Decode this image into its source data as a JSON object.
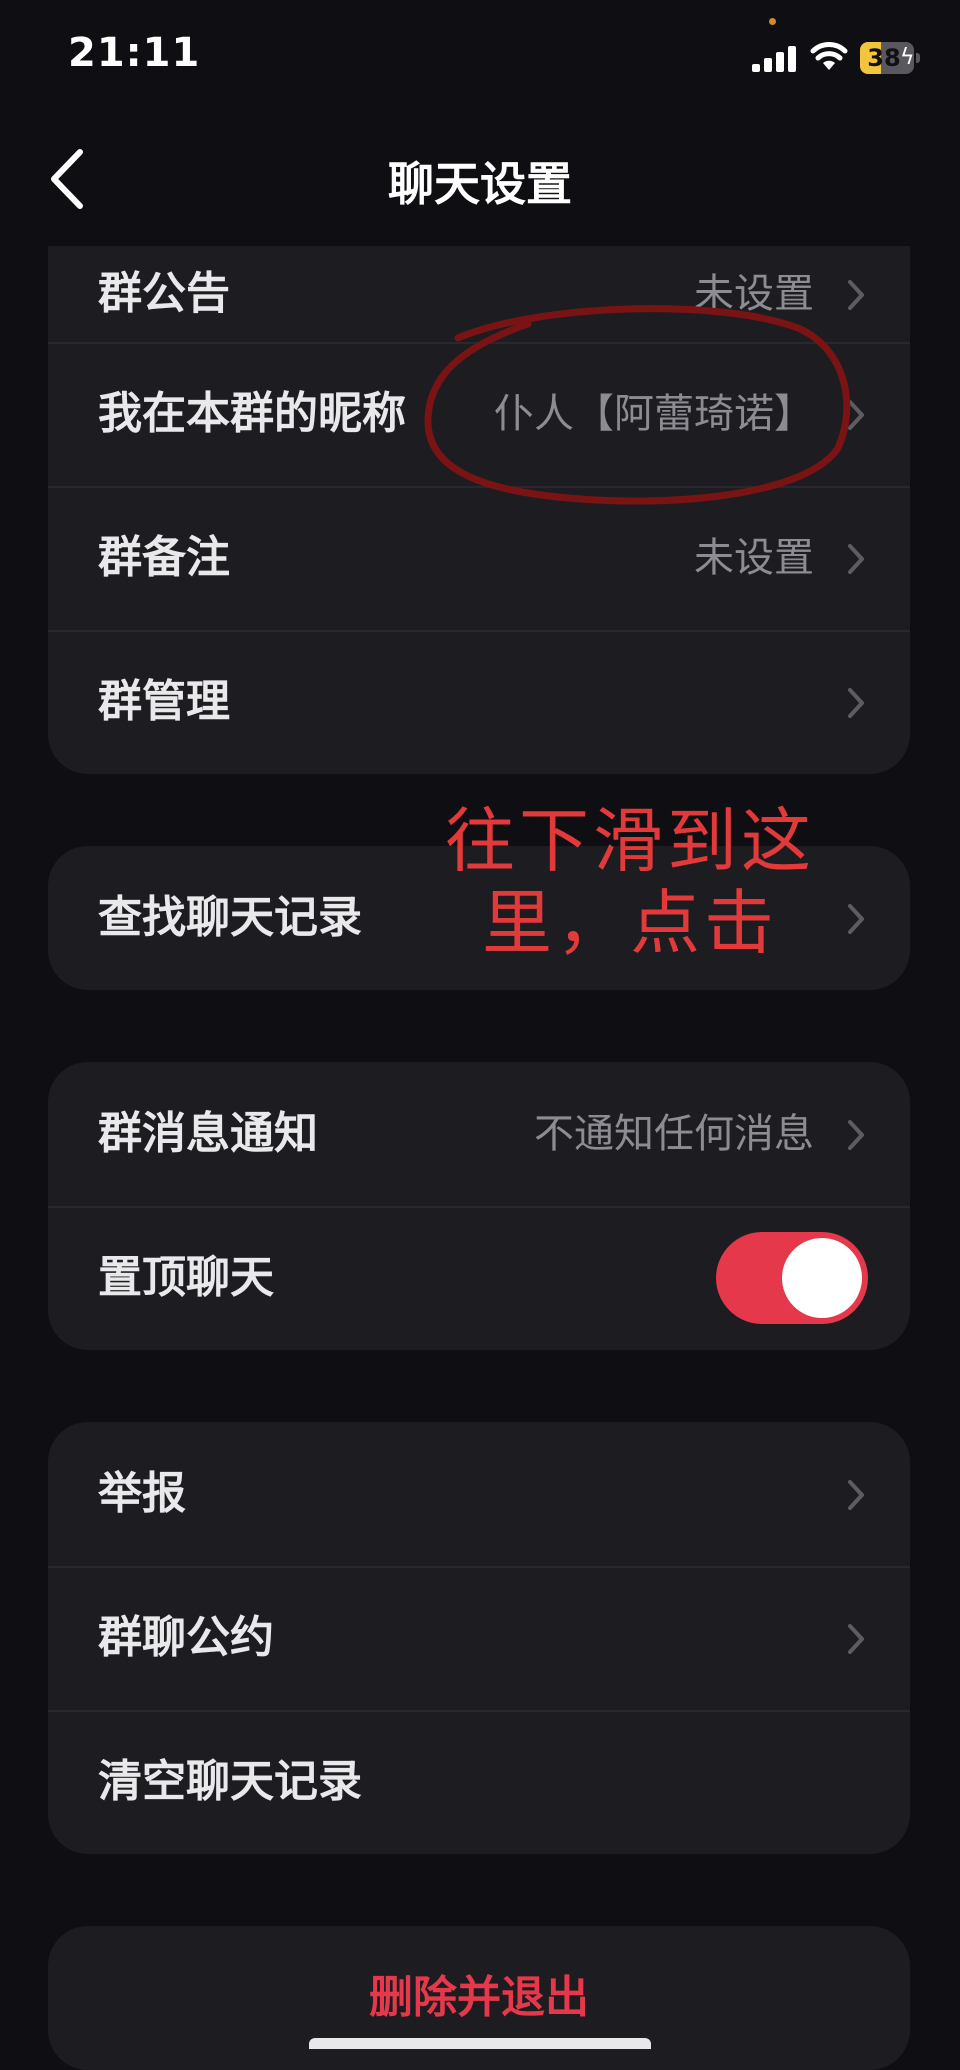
{
  "status_bar": {
    "time": "21:11",
    "battery": "38",
    "battery_level": 0.38
  },
  "nav": {
    "title": "聊天设置"
  },
  "group_card": {
    "announcement": {
      "label": "群公告",
      "value": "未设置"
    },
    "my_nickname": {
      "label": "我在本群的昵称",
      "value": "仆人【阿蕾琦诺】"
    },
    "remark": {
      "label": "群备注",
      "value": "未设置"
    },
    "management": {
      "label": "群管理"
    }
  },
  "search_card": {
    "search_history": {
      "label": "查找聊天记录"
    }
  },
  "notify_card": {
    "message_notification": {
      "label": "群消息通知",
      "value": "不通知任何消息"
    },
    "pin_chat": {
      "label": "置顶聊天",
      "on": true
    }
  },
  "report_card": {
    "report": {
      "label": "举报"
    },
    "convention": {
      "label": "群聊公约"
    },
    "clear_history": {
      "label": "清空聊天记录"
    }
  },
  "delete_card": {
    "label": "删除并退出"
  },
  "annotation": {
    "line1": "往下滑到这",
    "line2": "里，点击"
  },
  "colors": {
    "accent_red": "#e6384b",
    "annotation_red": "#e23a3a",
    "background": "#0f0f13",
    "card": "#1c1c21"
  }
}
